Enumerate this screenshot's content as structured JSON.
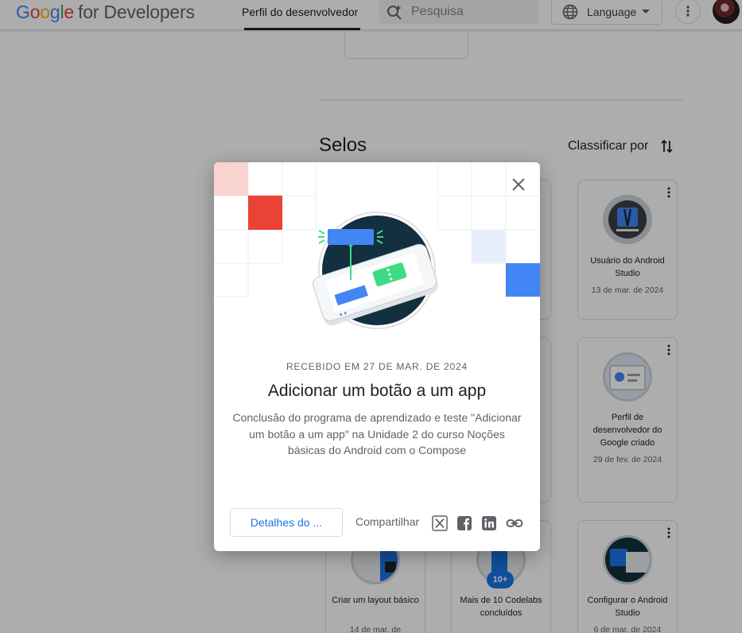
{
  "header": {
    "logo_google": [
      "G",
      "o",
      "o",
      "g",
      "l",
      "e"
    ],
    "logo_rest": "for Developers",
    "nav_tab": "Perfil do desenvolvedor",
    "search_placeholder": "Pesquisa",
    "language_label": "Language"
  },
  "page": {
    "section_title": "Selos",
    "sort_label": "Classificar por",
    "badges": [
      {
        "name": "Usuário do Android Studio",
        "date": "13 de mar. de 2024"
      },
      {
        "name": "Perfil de desenvolvedor do Google criado",
        "date": "29 de fev. de 2024"
      },
      {
        "name": "Criar um layout básico",
        "date": "14 de mar. de"
      },
      {
        "name": "Mais de 10 Codelabs concluídos",
        "date": "",
        "count": "10+"
      },
      {
        "name": "Configurar o Android Studio",
        "date": "6 de mar. de 2024"
      }
    ]
  },
  "dialog": {
    "received": "RECEBIDO EM 27 DE MAR. DE 2024",
    "title": "Adicionar um botão a um app",
    "description": "Conclusão do programa de aprendizado e teste \"Adicionar um botão a um app\" na Unidade 2 do curso Noções básicas do Android com o Compose",
    "details_button": "Detalhes do ...",
    "share_label": "Compartilhar",
    "share_icons": [
      "x-icon",
      "facebook-icon",
      "linkedin-icon",
      "link-icon"
    ]
  },
  "colors": {
    "accent_blue": "#1a73e8",
    "badge_red": "#ea4335",
    "badge_blue": "#4285f4",
    "badge_pink": "#f8d3d0",
    "badge_light_blue": "#e8eefc",
    "badge_dark": "#12303f",
    "badge_green": "#3ddc84"
  }
}
